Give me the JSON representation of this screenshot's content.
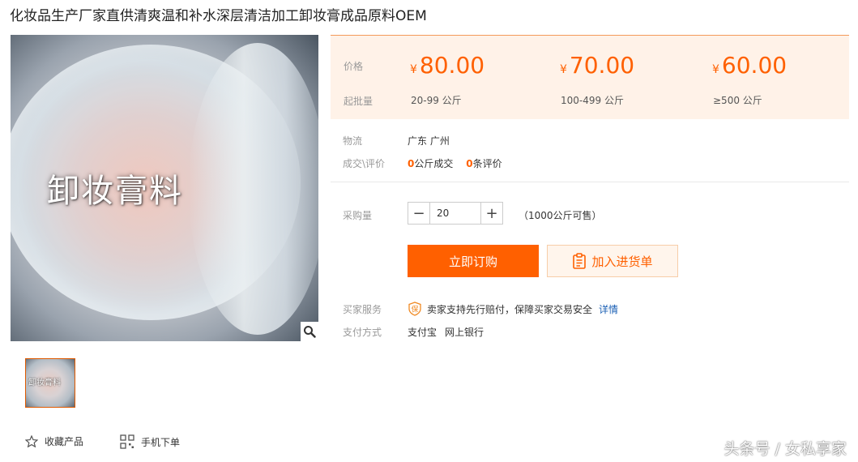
{
  "product": {
    "title": "化妆品生产厂家直供清爽温和补水深层清洁加工卸妆膏成品原料OEM",
    "image_label": "卸妆膏料",
    "thumbnail_label": "卸妆膏料"
  },
  "price_panel": {
    "price_label": "价格",
    "moq_label": "起批量",
    "tiers": [
      {
        "currency": "¥",
        "price": "80.00",
        "qty": "20-99 公斤"
      },
      {
        "currency": "¥",
        "price": "70.00",
        "qty": "100-499 公斤"
      },
      {
        "currency": "¥",
        "price": "60.00",
        "qty": "≥500 公斤"
      }
    ]
  },
  "logistics": {
    "label": "物流",
    "value": "广东 广州"
  },
  "deals": {
    "label": "成交\\评价",
    "sold_count": "0",
    "sold_text": "公斤成交",
    "review_count": "0",
    "review_text": "条评价"
  },
  "purchase": {
    "label": "采购量",
    "minus": "−",
    "plus": "+",
    "quantity": "20",
    "available": "（1000公斤可售）"
  },
  "actions": {
    "buy_now": "立即订购",
    "add_to_list": "加入进货单",
    "favorite": "收藏产品",
    "mobile_order": "手机下单"
  },
  "service": {
    "label": "买家服务",
    "text": "卖家支持先行赔付，保障买家交易安全",
    "link": "详情",
    "badge": "保"
  },
  "payment": {
    "label": "支付方式",
    "methods": [
      "支付宝",
      "网上银行"
    ]
  },
  "watermark": "头条号 / 女私享家",
  "colors": {
    "accent": "#ff6000",
    "panel_bg": "#fff2e8",
    "link": "#1a5fb4"
  }
}
